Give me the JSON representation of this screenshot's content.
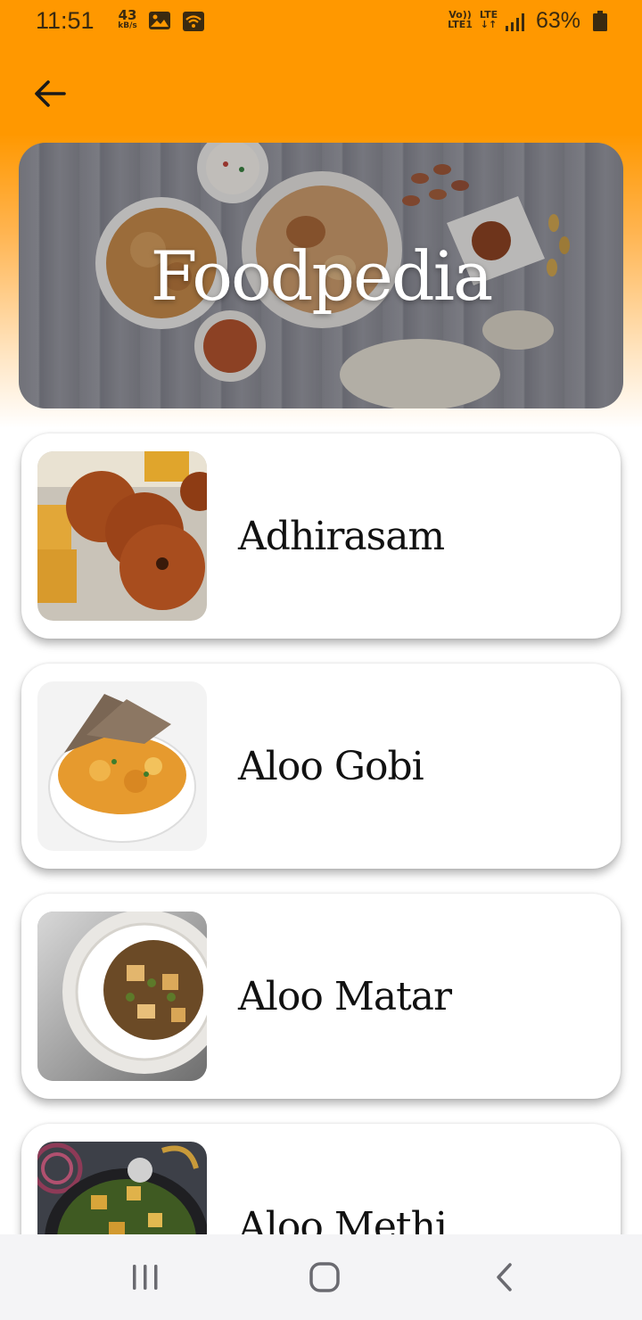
{
  "status_bar": {
    "time": "11:51",
    "net_speed_value": "43",
    "net_speed_unit": "kB/s",
    "volte_line1": "Vo))",
    "volte_line2": "LTE1",
    "lte_label": "LTE",
    "battery_percent": "63%"
  },
  "header": {
    "back_icon": "arrow-left-icon"
  },
  "banner": {
    "title": "Foodpedia"
  },
  "recipes": [
    {
      "name": "Adhirasam"
    },
    {
      "name": "Aloo Gobi"
    },
    {
      "name": "Aloo Matar"
    },
    {
      "name": "Aloo Methi"
    }
  ],
  "nav_bar": {
    "icons": [
      "recent-apps-icon",
      "home-icon",
      "back-icon"
    ]
  },
  "colors": {
    "accent": "#FF9800",
    "card_bg": "#FFFFFF",
    "nav_bg": "#F4F4F6"
  }
}
